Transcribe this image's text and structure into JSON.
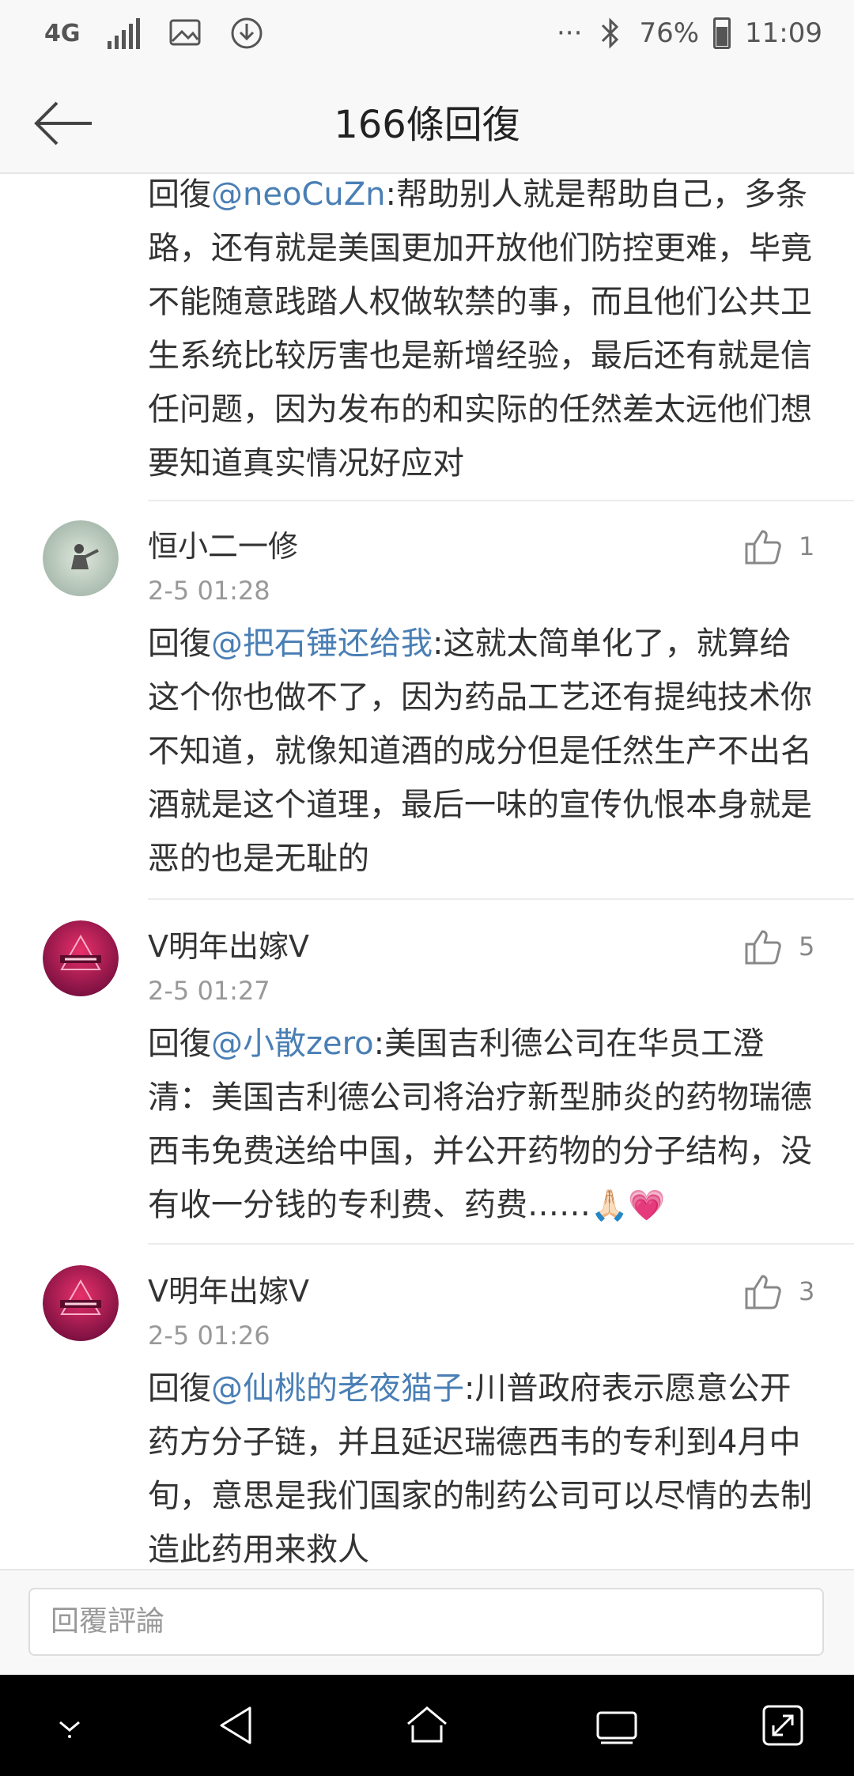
{
  "status_bar": {
    "network": "4G",
    "battery": "76%",
    "time": "11:09",
    "more": "···"
  },
  "header": {
    "title": "166條回復"
  },
  "comments": [
    {
      "reply_prefix": "回復",
      "mention": "@neoCuZn",
      "text": ":帮助别人就是帮助自己，多条路，还有就是美国更加开放他们防控更难，毕竟不能随意践踏人权做软禁的事，而且他们公共卫生系统比较厉害也是新增经验，最后还有就是信任问题，因为发布的和实际的任然差太远他们想要知道真实情况好应对"
    },
    {
      "username": "恒小二一修",
      "time": "2-5 01:28",
      "likes": "1",
      "reply_prefix": "回復",
      "mention": "@把石锤还给我",
      "text": ":这就太简单化了，就算给这个你也做不了，因为药品工艺还有提纯技术你不知道，就像知道酒的成分但是任然生产不出名酒就是这个道理，最后一味的宣传仇恨本身就是恶的也是无耻的"
    },
    {
      "username": "V明年出嫁V",
      "time": "2-5 01:27",
      "likes": "5",
      "reply_prefix": "回復",
      "mention": "@小散zero",
      "text": ":美国吉利德公司在华员工澄清：美国吉利德公司将治疗新型肺炎的药物瑞德西韦免费送给中国，并公开药物的分子结构，没有收一分钱的专利费、药费……",
      "emoji": "🙏🏻💗"
    },
    {
      "username": "V明年出嫁V",
      "time": "2-5 01:26",
      "likes": "3",
      "reply_prefix": "回復",
      "mention": "@仙桃的老夜猫子",
      "text": ":川普政府表示愿意公开药方分子链，并且延迟瑞德西韦的专利到4月中旬，意思是我们国家的制药公司可以尽情的去制造此药用来救人"
    }
  ],
  "reply_bar": {
    "placeholder": "回覆評論"
  },
  "icons": {
    "back": "arrow-left-icon",
    "like": "thumbs-up-icon",
    "nav": [
      "chevron-down-icon",
      "back-triangle-icon",
      "home-icon",
      "recents-icon",
      "expand-icon"
    ]
  },
  "colors": {
    "mention": "#4a7fb5",
    "text": "#333333",
    "meta": "#999999",
    "navbar": "#000000"
  }
}
